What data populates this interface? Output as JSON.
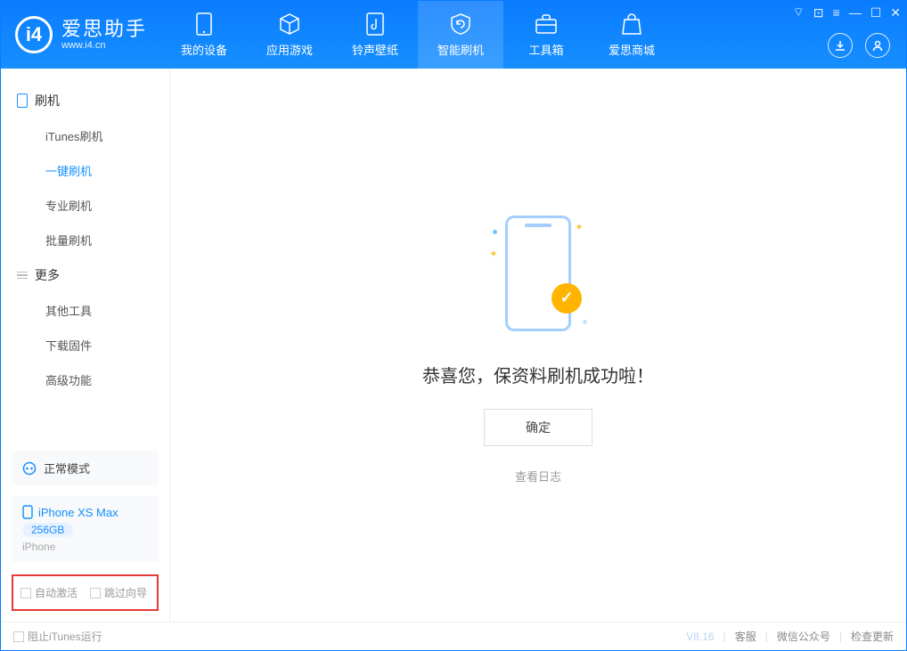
{
  "app": {
    "title": "爱思助手",
    "subtitle": "www.i4.cn"
  },
  "tabs": {
    "device": "我的设备",
    "apps": "应用游戏",
    "ring": "铃声壁纸",
    "flash": "智能刷机",
    "tools": "工具箱",
    "store": "爱思商城"
  },
  "sidebar": {
    "section1": "刷机",
    "items1": {
      "itunes": "iTunes刷机",
      "onekey": "一键刷机",
      "pro": "专业刷机",
      "batch": "批量刷机"
    },
    "section2": "更多",
    "items2": {
      "other": "其他工具",
      "firmware": "下载固件",
      "adv": "高级功能"
    }
  },
  "mode": {
    "label": "正常模式"
  },
  "device": {
    "name": "iPhone XS Max",
    "capacity": "256GB",
    "type": "iPhone"
  },
  "options": {
    "auto_activate": "自动激活",
    "skip_guide": "跳过向导"
  },
  "main": {
    "success": "恭喜您，保资料刷机成功啦！",
    "ok": "确定",
    "view_log": "查看日志"
  },
  "footer": {
    "block_itunes": "阻止iTunes运行",
    "version": "V8.16",
    "support": "客服",
    "wechat": "微信公众号",
    "update": "检查更新"
  }
}
